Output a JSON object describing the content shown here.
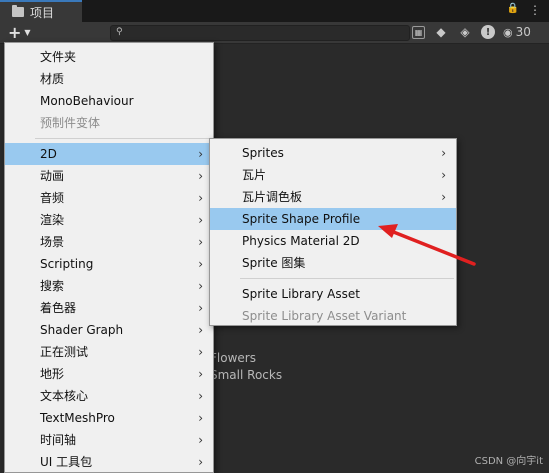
{
  "tab": {
    "title": "项目",
    "lock": "🔒",
    "more": "⋮"
  },
  "toolbar": {
    "create_plus": "+",
    "create_arrow": "▼",
    "search_icon": "⚲",
    "visibility_count": "30",
    "eye": "👁"
  },
  "background_items": [
    "Flowers",
    "Small Rocks"
  ],
  "menu1": {
    "items": [
      {
        "label": "文件夹",
        "submenu": false,
        "disabled": false
      },
      {
        "label": "材质",
        "submenu": false,
        "disabled": false
      },
      {
        "label": "MonoBehaviour",
        "submenu": false,
        "disabled": false
      },
      {
        "label": "预制件变体",
        "submenu": false,
        "disabled": true
      },
      {
        "separator": true
      },
      {
        "label": "2D",
        "submenu": true,
        "highlighted": true
      },
      {
        "label": "动画",
        "submenu": true
      },
      {
        "label": "音频",
        "submenu": true
      },
      {
        "label": "渲染",
        "submenu": true
      },
      {
        "label": "场景",
        "submenu": true
      },
      {
        "label": "Scripting",
        "submenu": true
      },
      {
        "label": "搜索",
        "submenu": true
      },
      {
        "label": "着色器",
        "submenu": true
      },
      {
        "label": "Shader Graph",
        "submenu": true
      },
      {
        "label": "正在测试",
        "submenu": true
      },
      {
        "label": "地形",
        "submenu": true
      },
      {
        "label": "文本核心",
        "submenu": true
      },
      {
        "label": "TextMeshPro",
        "submenu": true
      },
      {
        "label": "时间轴",
        "submenu": true
      },
      {
        "label": "UI 工具包",
        "submenu": true
      }
    ]
  },
  "menu2": {
    "items": [
      {
        "label": "Sprites",
        "submenu": true
      },
      {
        "label": "瓦片",
        "submenu": true
      },
      {
        "label": "瓦片调色板",
        "submenu": true
      },
      {
        "label": "Sprite Shape Profile",
        "highlighted": true
      },
      {
        "label": "Physics Material 2D"
      },
      {
        "label": "Sprite 图集"
      },
      {
        "separator": true
      },
      {
        "label": "Sprite Library Asset"
      },
      {
        "label": "Sprite Library Asset Variant",
        "disabled": true
      }
    ]
  },
  "chevron": "›",
  "watermark": "CSDN @向宇it",
  "colors": {
    "highlight": "#99c9ef",
    "menu_bg": "#f0f0f0",
    "arrow": "#e02020",
    "editor_bg": "#2a2a2a"
  }
}
